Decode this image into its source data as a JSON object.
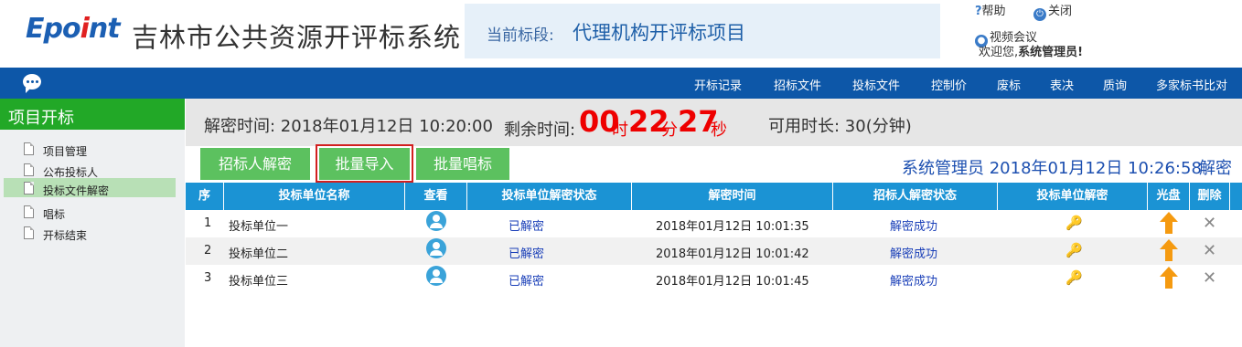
{
  "header": {
    "logo": "Epoint",
    "system_title": "吉林市公共资源开评标系统",
    "stage_label": "当前标段:",
    "stage_value": "代理机构开评标项目",
    "help": "帮助",
    "close": "关闭",
    "video": "视频会议",
    "welcome_prefix": "欢迎您,",
    "welcome_user": "系统管理员!"
  },
  "nav": {
    "items": [
      "开标记录",
      "招标文件",
      "投标文件",
      "控制价",
      "废标",
      "表决",
      "质询",
      "多家标书比对"
    ]
  },
  "sidebar": {
    "title": "项目开标",
    "items": [
      {
        "label": "项目管理"
      },
      {
        "label": "公布投标人"
      },
      {
        "label": "投标文件解密",
        "active": true
      },
      {
        "label": "唱标"
      },
      {
        "label": "开标结束"
      }
    ]
  },
  "timebar": {
    "decrypt_time": "解密时间: 2018年01月12日 10:20:00",
    "remain_label": "剩余时间:",
    "hours": "00",
    "hours_unit": "时",
    "minutes": "22",
    "minutes_unit": "分",
    "seconds": "27",
    "seconds_unit": "秒",
    "available": "可用时长: 30(分钟)"
  },
  "toolbar": {
    "btn_tender_decrypt": "招标人解密",
    "btn_batch_import": "批量导入",
    "btn_batch_sing": "批量唱标",
    "user_info": "系统管理员  2018年01月12日 10:26:58",
    "decrypt_link": "解密"
  },
  "table": {
    "headers": [
      "序",
      "投标单位名称",
      "查看",
      "投标单位解密状态",
      "解密时间",
      "招标人解密状态",
      "投标单位解密",
      "光盘",
      "删除"
    ],
    "rows": [
      {
        "no": "1",
        "name": "投标单位一",
        "status": "已解密",
        "time": "2018年01月12日 10:01:35",
        "tender_status": "解密成功"
      },
      {
        "no": "2",
        "name": "投标单位二",
        "status": "已解密",
        "time": "2018年01月12日 10:01:42",
        "tender_status": "解密成功"
      },
      {
        "no": "3",
        "name": "投标单位三",
        "status": "已解密",
        "time": "2018年01月12日 10:01:45",
        "tender_status": "解密成功"
      }
    ]
  },
  "colors": {
    "nav_bg": "#0d57a8",
    "sidebar_head": "#22a827",
    "button_green": "#5cc15f",
    "table_head": "#1b93d4",
    "countdown": "#e00000"
  }
}
